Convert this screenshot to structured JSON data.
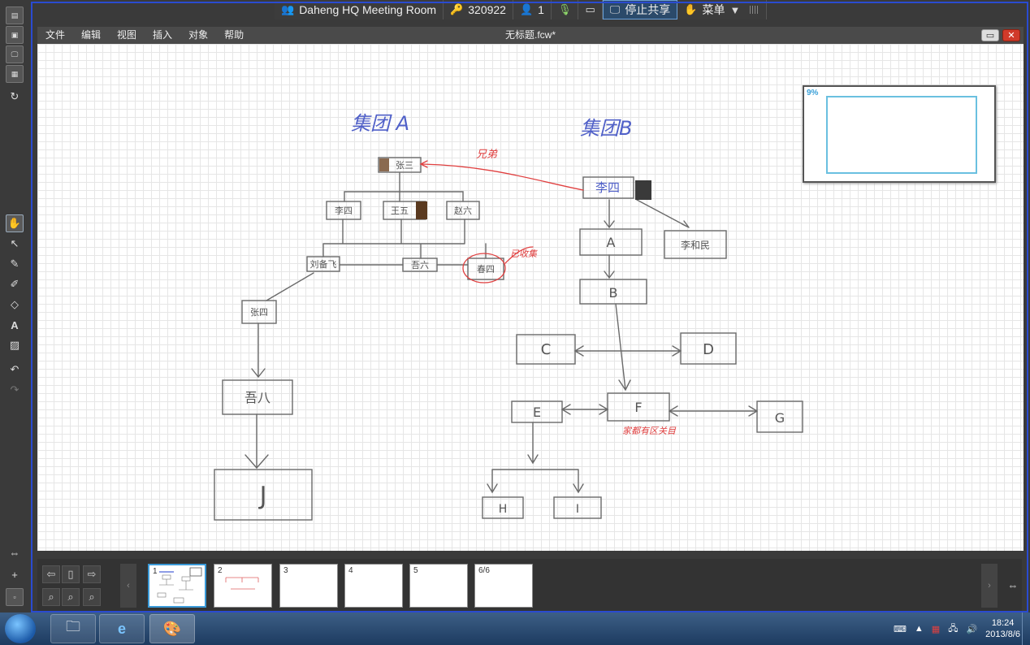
{
  "meeting_bar": {
    "room_name": "Daheng HQ Meeting Room",
    "room_id": "320922",
    "participants": "1",
    "share_label": "停止共享",
    "menu_label": "菜单"
  },
  "menubar": {
    "items": [
      "文件",
      "编辑",
      "视图",
      "插入",
      "对象",
      "帮助"
    ],
    "doc_title": "无标题.fcw*"
  },
  "minimap": {
    "zoom": "9%"
  },
  "pages": {
    "thumbs": [
      "1",
      "2",
      "3",
      "4",
      "5",
      "6/6"
    ]
  },
  "taskbar": {
    "time": "18:24",
    "date": "2013/8/6"
  },
  "drawing": {
    "group_a_title": "集团 A",
    "group_b_title": "集团B",
    "nodes_a": [
      "张三",
      "李四",
      "王五",
      "赵六",
      "刘备飞",
      "吾六",
      "春四",
      "张四",
      "吾八",
      "J"
    ],
    "nodes_b": [
      "李四",
      "A",
      "B",
      "C",
      "D",
      "E",
      "F",
      "G",
      "H",
      "I",
      "李和民"
    ],
    "annotations": [
      "兄弟",
      "已收集",
      "家都有区关目"
    ]
  },
  "colors": {
    "frame_blue": "#2a4bd0",
    "ink_gray": "#6a6a6a",
    "ink_blue": "#5060c8",
    "ink_red": "#e04040"
  }
}
